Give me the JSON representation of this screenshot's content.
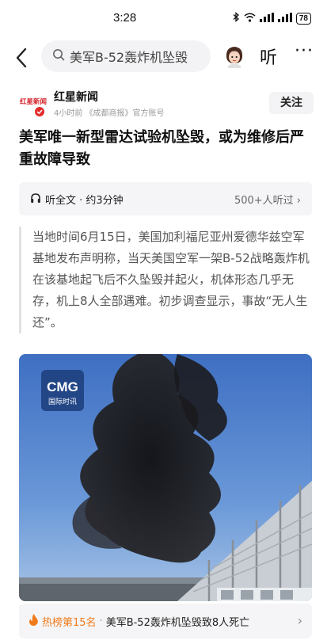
{
  "status_bar": {
    "time": "3:28",
    "battery": "78"
  },
  "top_nav": {
    "search_text": "美军B-52轰炸机坠毁",
    "listen_label": "听",
    "more_label": "···"
  },
  "author": {
    "logo_text": "红星新闻",
    "name": "红星新闻",
    "meta": "4小时前 《成都商报》官方账号",
    "follow_label": "关注"
  },
  "article": {
    "title": "美军唯一新型雷达试验机坠毁，或为维修后严重故障导致",
    "quote": "当地时间6月15日，美国加利福尼亚州爱德华兹空军基地发布声明称，当天美国空军一架B-52战略轰炸机在该基地起飞后不久坠毁并起火，机体形态几乎无存，机上8人全部遇难。初步调查显示，事故“无人生还”。"
  },
  "listen_bar": {
    "label": "听全文 · 约3分钟",
    "listeners": "500+人听过 ›"
  },
  "image": {
    "logo_main": "CMG",
    "logo_sub": "国际时讯"
  },
  "hot_bar": {
    "rank": "热榜第15名",
    "separator": "·",
    "text": "美军B-52轰炸机坠毁致8人死亡",
    "arrow": "›"
  },
  "colors": {
    "accent_orange": "#f07a1a",
    "brand_red": "#d4232b",
    "verified_red": "#e32b2b"
  }
}
